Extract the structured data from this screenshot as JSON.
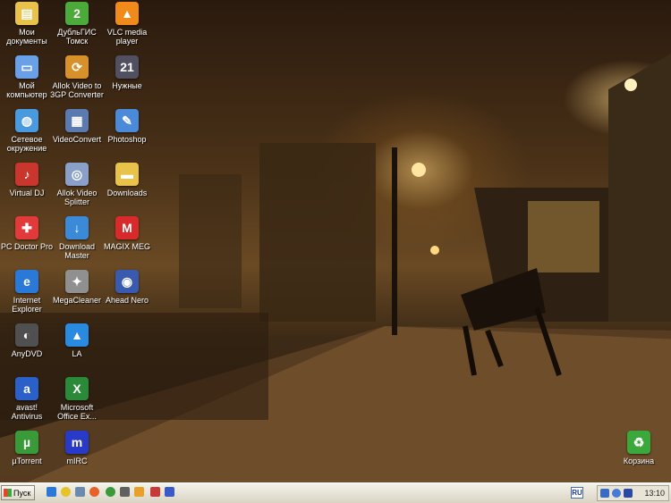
{
  "desktop": {
    "icons": [
      {
        "label": "Мои документы",
        "icon": "my-documents-icon",
        "color": "#e8c24a"
      },
      {
        "label": "Мой компьютер",
        "icon": "my-computer-icon",
        "color": "#6aa0e8"
      },
      {
        "label": "Сетевое окружение",
        "icon": "network-places-icon",
        "color": "#4a9ae0"
      },
      {
        "label": "Virtual DJ",
        "icon": "virtual-dj-icon",
        "color": "#c8362e"
      },
      {
        "label": "PC Doctor Pro",
        "icon": "pc-doctor-icon",
        "color": "#e23a3a"
      },
      {
        "label": "Internet Explorer",
        "icon": "internet-explorer-icon",
        "color": "#2a78d8"
      },
      {
        "label": "AnyDVD",
        "icon": "anydvd-icon",
        "color": "#505050"
      },
      {
        "label": "avast! Antivirus",
        "icon": "avast-icon",
        "color": "#2a60c8"
      },
      {
        "label": "µTorrent",
        "icon": "utorrent-icon",
        "color": "#3a9a3a"
      },
      {
        "label": "ДубльГИС Томск",
        "icon": "dublgis-icon",
        "color": "#4caa3a"
      },
      {
        "label": "Allok Video to 3GP Converter",
        "icon": "allok-converter-icon",
        "color": "#d8902a"
      },
      {
        "label": "VideoConvert",
        "icon": "videoconvert-icon",
        "color": "#5a7ab0"
      },
      {
        "label": "Allok Video Splitter",
        "icon": "allok-splitter-icon",
        "color": "#8aa0c8"
      },
      {
        "label": "Download Master",
        "icon": "download-master-icon",
        "color": "#3a8ad8"
      },
      {
        "label": "MegaCleaner",
        "icon": "megacleaner-icon",
        "color": "#909090"
      },
      {
        "label": "LA",
        "icon": "la-icon",
        "color": "#2a8ae0"
      },
      {
        "label": "Microsoft Office Ex...",
        "icon": "excel-icon",
        "color": "#2a8a3a"
      },
      {
        "label": "mIRC",
        "icon": "mirc-icon",
        "color": "#2a3ac8"
      },
      {
        "label": "VLC media player",
        "icon": "vlc-icon",
        "color": "#f08a1a"
      },
      {
        "label": "Нужные",
        "icon": "calendar-icon",
        "color": "#505060"
      },
      {
        "label": "Photoshop",
        "icon": "photoshop-icon",
        "color": "#4a8ad8"
      },
      {
        "label": "Downloads",
        "icon": "folder-icon",
        "color": "#e8c24a"
      },
      {
        "label": "MAGIX MEG",
        "icon": "magix-icon",
        "color": "#d82a2a"
      },
      {
        "label": "Ahead Nero",
        "icon": "nero-icon",
        "color": "#3a5ab0"
      }
    ],
    "recycle_bin": {
      "label": "Корзина",
      "icon": "recycle-bin-icon",
      "color": "#3aa83a"
    }
  },
  "taskbar": {
    "start_label": "Пуск",
    "quick_launch": [
      {
        "icon": "ie-quicklaunch-icon",
        "color": "#2a78d8"
      },
      {
        "icon": "chrome-quicklaunch-icon",
        "color": "#e8c22a"
      },
      {
        "icon": "settings-quicklaunch-icon",
        "color": "#6a8ab0"
      },
      {
        "icon": "firefox-quicklaunch-icon",
        "color": "#e8602a"
      },
      {
        "icon": "torrent-quicklaunch-icon",
        "color": "#3a9a3a"
      },
      {
        "icon": "app-quicklaunch-icon",
        "color": "#606060"
      },
      {
        "icon": "winamp-quicklaunch-icon",
        "color": "#e8a02a"
      },
      {
        "icon": "tool-quicklaunch-icon",
        "color": "#c83a3a"
      },
      {
        "icon": "save-quicklaunch-icon",
        "color": "#3a5ac8"
      }
    ],
    "language": "RU",
    "tray_icons": [
      {
        "icon": "network-tray-icon",
        "color": "#3a6ac8"
      },
      {
        "icon": "volume-tray-icon",
        "color": "#4a7ad8"
      },
      {
        "icon": "safe-remove-tray-icon",
        "color": "#2a4aa8"
      }
    ],
    "clock": "13:10"
  }
}
